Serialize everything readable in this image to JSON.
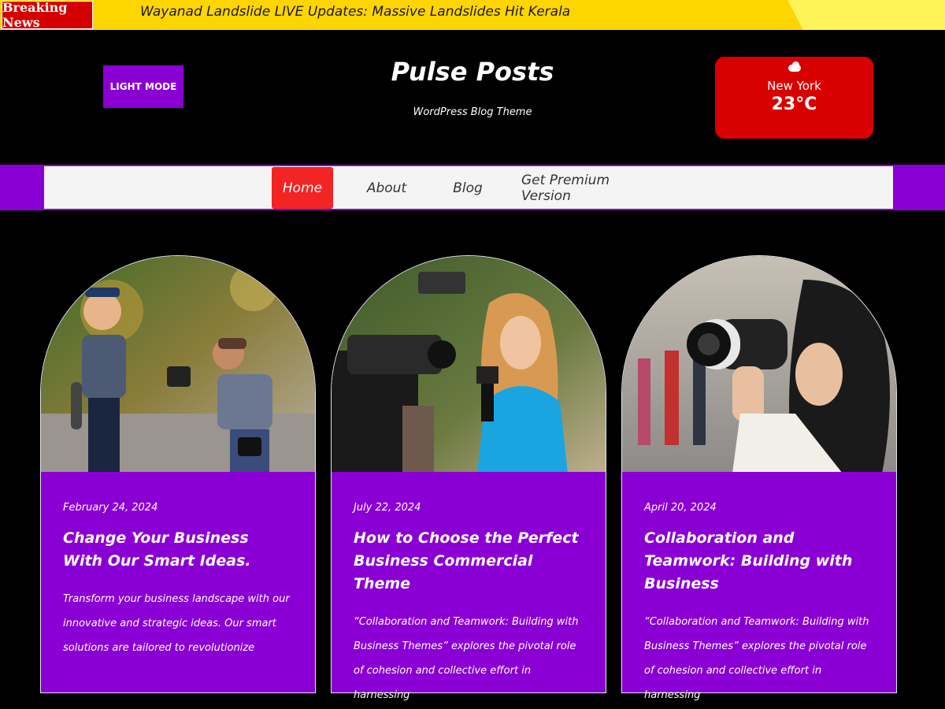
{
  "ticker": {
    "label": "Breaking News",
    "headline": "Wayanad Landslide LIVE Updates: Massive Landslides Hit Kerala"
  },
  "header": {
    "mode_button": "LIGHT MODE",
    "site_title": "Pulse Posts",
    "tagline": "WordPress Blog Theme"
  },
  "weather": {
    "icon": "cloud-icon",
    "city": "New York",
    "temp": "23°C"
  },
  "nav": {
    "items": [
      {
        "label": "Home",
        "active": true
      },
      {
        "label": "About",
        "active": false
      },
      {
        "label": "Blog",
        "active": false
      },
      {
        "label": "Get Premium Version",
        "active": false
      }
    ]
  },
  "posts": [
    {
      "date": "February 24, 2024",
      "title": "Change Your Business With Our Smart Ideas.",
      "excerpt": "Transform your business landscape with our innovative and strategic ideas. Our smart solutions are tailored to revolutionize"
    },
    {
      "date": "July 22, 2024",
      "title": "How to Choose the Perfect Business Commercial Theme",
      "excerpt": "“Collaboration and Teamwork: Building with Business Themes” explores the pivotal role of cohesion and collective effort in harnessing"
    },
    {
      "date": "April 20, 2024",
      "title": "Collaboration and Teamwork: Building with Business",
      "excerpt": "“Collaboration and Teamwork: Building with Business Themes” explores the pivotal role of cohesion and collective effort in harnessing"
    }
  ],
  "colors": {
    "accent": "#8a00d4",
    "ticker_bg": "#ffd500",
    "breaking_red": "#d40000",
    "active_nav": "#f22424"
  }
}
